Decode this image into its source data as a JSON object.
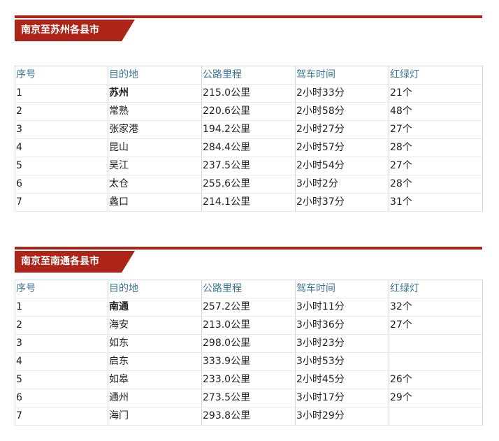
{
  "sections": [
    {
      "title": "南京至苏州各县市",
      "headers": [
        "序号",
        "目的地",
        "公路里程",
        "驾车时间",
        "红绿灯"
      ],
      "rows": [
        [
          "1",
          "苏州",
          "215.0公里",
          "2小时33分",
          "21个"
        ],
        [
          "2",
          "常熟",
          "220.6公里",
          "2小时58分",
          "48个"
        ],
        [
          "3",
          "张家港",
          "194.2公里",
          "2小时27分",
          "27个"
        ],
        [
          "4",
          "昆山",
          "284.4公里",
          "2小时57分",
          "28个"
        ],
        [
          "5",
          "吴江",
          "237.5公里",
          "2小时54分",
          "27个"
        ],
        [
          "6",
          "太仓",
          "255.6公里",
          "3小时2分",
          "28个"
        ],
        [
          "7",
          "蠡口",
          "214.1公里",
          "2小时37分",
          "31个"
        ]
      ]
    },
    {
      "title": "南京至南通各县市",
      "headers": [
        "序号",
        "目的地",
        "公路里程",
        "驾车时间",
        "红绿灯"
      ],
      "rows": [
        [
          "1",
          "南通",
          "257.2公里",
          "3小时11分",
          "32个"
        ],
        [
          "2",
          "海安",
          "213.0公里",
          "3小时36分",
          "27个"
        ],
        [
          "3",
          "如东",
          "298.0公里",
          "3小时23分",
          ""
        ],
        [
          "4",
          "启东",
          "333.9公里",
          "3小时53分",
          ""
        ],
        [
          "5",
          "如皋",
          "233.0公里",
          "2小时45分",
          "26个"
        ],
        [
          "6",
          "通州",
          "273.5公里",
          "3小时17分",
          "29个"
        ],
        [
          "7",
          "海门",
          "293.8公里",
          "3小时29分",
          ""
        ]
      ]
    }
  ],
  "colors": {
    "accent_red": "#ad2419",
    "header_text": "#3a7594",
    "border": "#d6d6d6"
  }
}
